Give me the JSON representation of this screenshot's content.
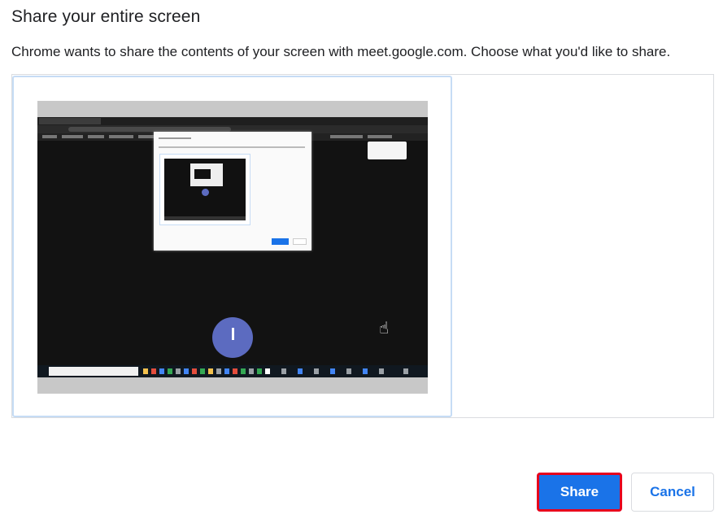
{
  "dialog": {
    "title": "Share your entire screen",
    "description": "Chrome wants to share the contents of your screen with meet.google.com. Choose what you'd like to share."
  },
  "sources": [
    {
      "kind": "entire-screen",
      "selected": true
    }
  ],
  "buttons": {
    "share_label": "Share",
    "cancel_label": "Cancel"
  },
  "colors": {
    "accent": "#1a73e8",
    "share_button_outline": "#e8001c",
    "selected_border": "#c6dcf5",
    "meet_circle": "#5c6bc0"
  },
  "icons": {
    "cursor": "hand-pointer-icon"
  }
}
